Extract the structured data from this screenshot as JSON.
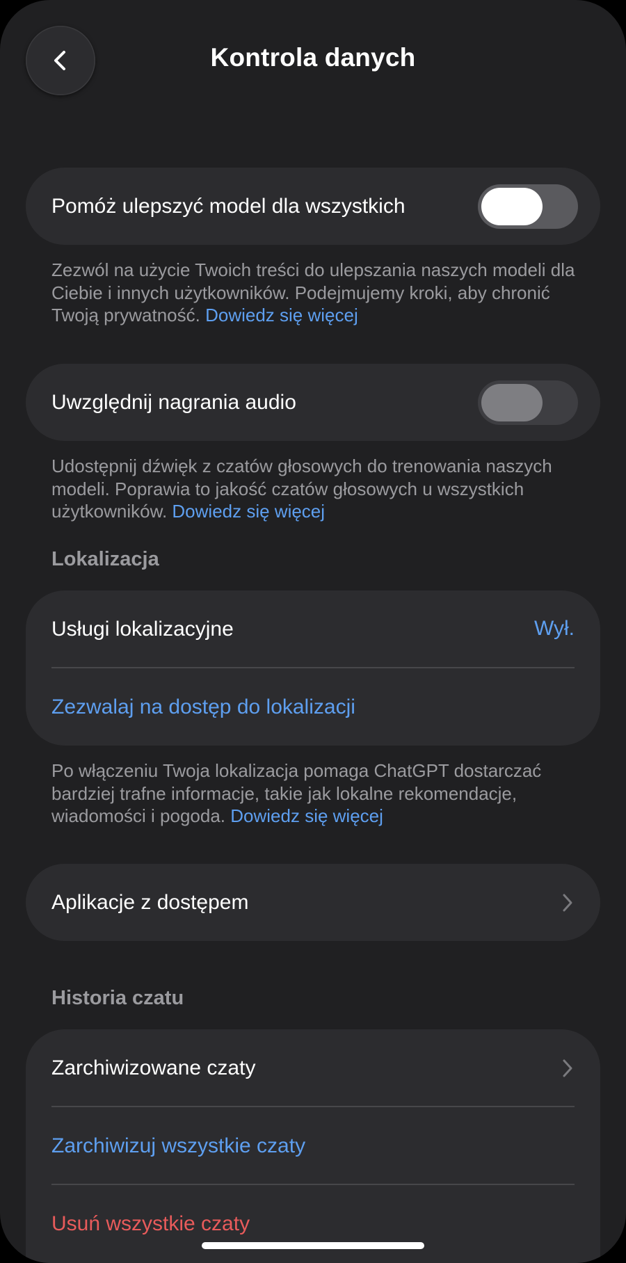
{
  "header": {
    "title": "Kontrola danych",
    "back_icon": "chevron-left-icon"
  },
  "improve_model": {
    "label": "Pomóż ulepszyć model dla wszystkich",
    "toggle_on": false,
    "description": "Zezwól na użycie Twoich treści do ulepszania naszych modeli dla Ciebie i innych użytkowników. Podejmujemy kroki, aby chronić Twoją prywatność.",
    "learn_more": "Dowiedz się więcej"
  },
  "audio": {
    "label": "Uwzględnij nagrania audio",
    "toggle_on": false,
    "toggle_disabled": true,
    "description": "Udostępnij dźwięk z czatów głosowych do trenowania naszych modeli. Poprawia to jakość czatów głosowych u wszystkich użytkowników.",
    "learn_more": "Dowiedz się więcej"
  },
  "location": {
    "section_title": "Lokalizacja",
    "services_label": "Usługi lokalizacyjne",
    "services_value": "Wył.",
    "allow_access_label": "Zezwalaj na dostęp do lokalizacji",
    "description": "Po włączeniu Twoja lokalizacja pomaga ChatGPT dostarczać bardziej trafne informacje, takie jak lokalne rekomendacje, wiadomości i pogoda.",
    "learn_more": "Dowiedz się więcej"
  },
  "apps": {
    "label": "Aplikacje z dostępem"
  },
  "chat_history": {
    "section_title": "Historia czatu",
    "archived_label": "Zarchiwizowane czaty",
    "archive_all_label": "Zarchiwizuj wszystkie czaty",
    "delete_all_label": "Usuń wszystkie czaty"
  },
  "colors": {
    "background": "#202022",
    "card": "#2c2c2f",
    "link": "#5e9ff0",
    "danger": "#e85b5b",
    "secondary_text": "#9b9b9f"
  }
}
